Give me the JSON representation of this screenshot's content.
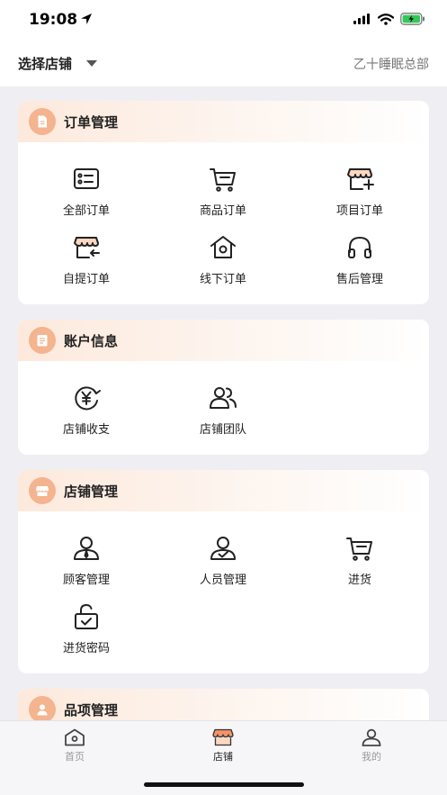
{
  "status_bar": {
    "time": "19:08"
  },
  "top_bar": {
    "store_select_label": "选择店铺",
    "store_name": "乙十睡眠总部"
  },
  "sections": [
    {
      "title": "订单管理",
      "items": [
        {
          "label": "全部订单"
        },
        {
          "label": "商品订单"
        },
        {
          "label": "项目订单"
        },
        {
          "label": "自提订单"
        },
        {
          "label": "线下订单"
        },
        {
          "label": "售后管理"
        }
      ]
    },
    {
      "title": "账户信息",
      "items": [
        {
          "label": "店铺收支"
        },
        {
          "label": "店铺团队"
        }
      ]
    },
    {
      "title": "店铺管理",
      "items": [
        {
          "label": "顾客管理"
        },
        {
          "label": "人员管理"
        },
        {
          "label": "进货"
        },
        {
          "label": "进货密码"
        }
      ]
    },
    {
      "title": "品项管理"
    }
  ],
  "tabbar": {
    "tabs": [
      {
        "label": "首页"
      },
      {
        "label": "店铺"
      },
      {
        "label": "我的"
      }
    ],
    "active": "店铺"
  },
  "colors": {
    "accent": "#f4b48f",
    "header_gradient": "#fde9dc",
    "background": "#efeff3"
  }
}
